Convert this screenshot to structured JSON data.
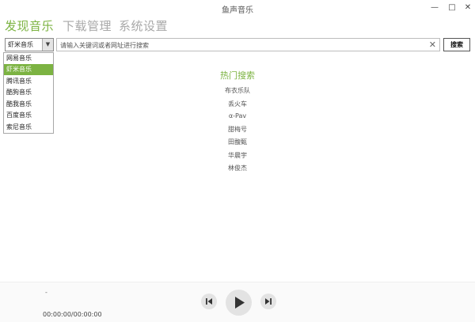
{
  "window": {
    "title": "鱼声音乐",
    "minimize_icon": "minimize-icon",
    "maximize_icon": "maximize-icon",
    "close_icon": "close-icon",
    "minimize_glyph": "—",
    "maximize_glyph": "□",
    "close_glyph": "✕"
  },
  "nav": {
    "tabs": [
      {
        "label": "发现音乐",
        "active": true
      },
      {
        "label": "下载管理",
        "active": false
      },
      {
        "label": "系统设置",
        "active": false
      }
    ],
    "accent_color": "#7cb342",
    "inactive_color": "#a9a9a9"
  },
  "source": {
    "selected": "虾米音乐",
    "arrow_glyph": "▼",
    "options": [
      "网易音乐",
      "虾米音乐",
      "腾讯音乐",
      "酷狗音乐",
      "酷我音乐",
      "百度音乐",
      "索尼音乐"
    ],
    "highlighted_index": 1
  },
  "search": {
    "placeholder": "请输入关键词或者网址进行搜索",
    "value": "",
    "clear_glyph": "✕",
    "button_label": "搜索"
  },
  "hot": {
    "title": "热门搜索",
    "items": [
      "布衣乐队",
      "丢火车",
      "α-Pav",
      "甜梅号",
      "田馥甄",
      "华晨宇",
      "林俊杰"
    ]
  },
  "player": {
    "song": "-",
    "time": "00:00:00/00:00:00",
    "icons": [
      "skip-previous-icon",
      "play-icon",
      "skip-next-icon"
    ]
  }
}
